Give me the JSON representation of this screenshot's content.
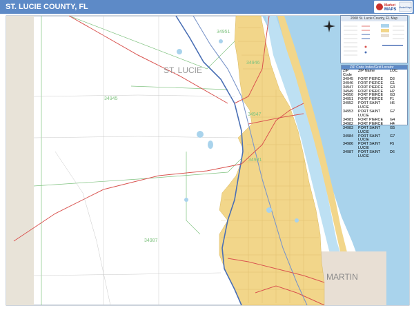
{
  "header": {
    "title": "ST. LUCIE COUNTY, FL"
  },
  "logo": {
    "text_top": "Market",
    "text_mid": "MAPS",
    "badge": "Market Maps"
  },
  "map_labels": {
    "county": "ST. LUCIE",
    "neighbor": "MARTIN",
    "zip_labels": [
      {
        "code": "34951"
      },
      {
        "code": "34946"
      },
      {
        "code": "34945"
      },
      {
        "code": "34947"
      },
      {
        "code": "34981"
      },
      {
        "code": "34987"
      }
    ]
  },
  "legend": {
    "title": "2008 St. Lucie County, FL Map"
  },
  "zip_locator": {
    "title": "ZIP Code Index/Grid Locator",
    "headers": [
      "ZIP Code",
      "ZIP Name",
      "LOC"
    ],
    "rows": [
      [
        "34945",
        "FORT PIERCE",
        "D3"
      ],
      [
        "34946",
        "FORT PIERCE",
        "G1"
      ],
      [
        "34947",
        "FORT PIERCE",
        "G3"
      ],
      [
        "34949",
        "FORT PIERCE",
        "H2"
      ],
      [
        "34950",
        "FORT PIERCE",
        "G3"
      ],
      [
        "34951",
        "FORT PIERCE",
        "F1"
      ],
      [
        "34952",
        "PORT SAINT LUCIE",
        "H6"
      ],
      [
        "34953",
        "PORT SAINT LUCIE",
        "G7"
      ],
      [
        "34981",
        "FORT PIERCE",
        "G4"
      ],
      [
        "34982",
        "FORT PIERCE",
        "H4"
      ],
      [
        "34983",
        "PORT SAINT LUCIE",
        "G5"
      ],
      [
        "34984",
        "PORT SAINT LUCIE",
        "G7"
      ],
      [
        "34986",
        "PORT SAINT LUCIE",
        "F5"
      ],
      [
        "34987",
        "PORT SAINT LUCIE",
        "D6"
      ]
    ]
  },
  "colors": {
    "header": "#5d8ac7",
    "urban": "#f2d68a",
    "water": "#a9d3ec",
    "neighbor": "#e8dfd4",
    "west_strip": "#e8e3d8",
    "major_road": "#d9534f",
    "highway": "#4a6fb5",
    "zip_line": "#7fc27f"
  }
}
